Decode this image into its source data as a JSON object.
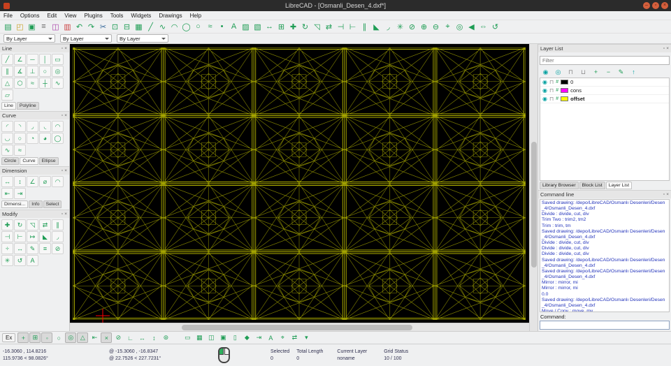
{
  "window": {
    "title": "LibreCAD - [Osmanli_Desen_4.dxf*]",
    "controls": {
      "minimize": "–",
      "maximize": "▫",
      "close": "×"
    }
  },
  "dock_icons": {
    "float": "▫",
    "close": "×"
  },
  "menu": {
    "items": [
      "File",
      "Options",
      "Edit",
      "View",
      "Plugins",
      "Tools",
      "Widgets",
      "Drawings",
      "Help"
    ]
  },
  "toolbar_main": {
    "icons": [
      {
        "name": "new-file-icon",
        "glyph": "▤"
      },
      {
        "name": "open-file-icon",
        "glyph": "◰",
        "color": "#c9a227"
      },
      {
        "name": "save-icon",
        "glyph": "▣"
      },
      {
        "name": "print-icon",
        "glyph": "≡",
        "color": "#666666"
      },
      {
        "name": "print-preview-icon",
        "glyph": "◫",
        "color": "#aa44aa"
      },
      {
        "name": "export-pdf-icon",
        "glyph": "▥",
        "color": "#cc4444"
      },
      {
        "name": "undo-icon",
        "glyph": "↶"
      },
      {
        "name": "redo-icon",
        "glyph": "↷"
      },
      {
        "name": "cut-icon",
        "glyph": "✂",
        "color": "#336699"
      },
      {
        "name": "copy-icon",
        "glyph": "⊡"
      },
      {
        "name": "paste-icon",
        "glyph": "⊟"
      },
      {
        "name": "grid-icon",
        "glyph": "▦"
      },
      {
        "name": "line-icon",
        "glyph": "╱"
      },
      {
        "name": "polyline-icon",
        "glyph": "∿"
      },
      {
        "name": "arc-icon",
        "glyph": "◠"
      },
      {
        "name": "circle-icon",
        "glyph": "◯"
      },
      {
        "name": "ellipse-icon",
        "glyph": "○"
      },
      {
        "name": "spline-icon",
        "glyph": "≈"
      },
      {
        "name": "point-icon",
        "glyph": "•"
      },
      {
        "name": "text-icon",
        "glyph": "A"
      },
      {
        "name": "hatch-icon",
        "glyph": "▨"
      },
      {
        "name": "image-icon",
        "glyph": "▧"
      },
      {
        "name": "dimension-icon",
        "glyph": "↔"
      },
      {
        "name": "block-icon",
        "glyph": "⊞"
      },
      {
        "name": "move-icon",
        "glyph": "✚"
      },
      {
        "name": "rotate-icon",
        "glyph": "↻"
      },
      {
        "name": "scale-icon",
        "glyph": "◹"
      },
      {
        "name": "mirror-icon",
        "glyph": "⇄"
      },
      {
        "name": "trim-icon",
        "glyph": "⊣"
      },
      {
        "name": "lengthen-icon",
        "glyph": "⊢"
      },
      {
        "name": "offset-icon",
        "glyph": "∥"
      },
      {
        "name": "bevel-icon",
        "glyph": "◣"
      },
      {
        "name": "fillet-icon",
        "glyph": "◞"
      },
      {
        "name": "explode-icon",
        "glyph": "✳"
      },
      {
        "name": "delete-icon",
        "glyph": "⊘"
      },
      {
        "name": "zoom-in-icon",
        "glyph": "⊕"
      },
      {
        "name": "zoom-out-icon",
        "glyph": "⊖"
      },
      {
        "name": "zoom-window-icon",
        "glyph": "⌖"
      },
      {
        "name": "zoom-auto-icon",
        "glyph": "◎"
      },
      {
        "name": "zoom-previous-icon",
        "glyph": "◀"
      },
      {
        "name": "pan-icon",
        "glyph": "⇔"
      },
      {
        "name": "redraw-icon",
        "glyph": "↺"
      }
    ]
  },
  "pen_toolbar": {
    "combos": [
      {
        "value": "By Layer"
      },
      {
        "value": "By Layer"
      },
      {
        "value": "By Layer"
      }
    ]
  },
  "left_dock": {
    "line_panel": {
      "title": "Line",
      "icons": [
        {
          "name": "line-two-points-icon",
          "glyph": "╱"
        },
        {
          "name": "line-angle-icon",
          "glyph": "∠"
        },
        {
          "name": "line-horizontal-icon",
          "glyph": "─"
        },
        {
          "name": "line-vertical-icon",
          "glyph": "│"
        },
        {
          "name": "line-rectangle-icon",
          "glyph": "▭"
        },
        {
          "name": "line-parallel-icon",
          "glyph": "∥"
        },
        {
          "name": "line-bisector-icon",
          "glyph": "∡"
        },
        {
          "name": "line-perpendicular-icon",
          "glyph": "⊥"
        },
        {
          "name": "line-tangent-point-icon",
          "glyph": "○"
        },
        {
          "name": "line-tangent-circles-icon",
          "glyph": "◎"
        },
        {
          "name": "line-polygon-icon",
          "glyph": "△"
        },
        {
          "name": "line-polygon-two-vertex-icon",
          "glyph": "⬡"
        },
        {
          "name": "line-freehand-icon",
          "glyph": "≈"
        },
        {
          "name": "line-cross-icon",
          "glyph": "┼"
        },
        {
          "name": "line-wave-icon",
          "glyph": "∿"
        },
        {
          "name": "line-ortho-icon",
          "glyph": "▱"
        }
      ],
      "tabs": [
        {
          "label": "Line",
          "active": true
        },
        {
          "label": "Polyline"
        }
      ]
    },
    "curve_panel": {
      "title": "Curve",
      "icons": [
        {
          "name": "arc-three-points-icon",
          "glyph": "◜"
        },
        {
          "name": "arc-center-point-icon",
          "glyph": "◝"
        },
        {
          "name": "arc-tangent-icon",
          "glyph": "◞"
        },
        {
          "name": "arc-concentric-icon",
          "glyph": "◟"
        },
        {
          "name": "arc-top-icon",
          "glyph": "◠"
        },
        {
          "name": "arc-bottom-icon",
          "glyph": "◡"
        },
        {
          "name": "circle-center-icon",
          "glyph": "○"
        },
        {
          "name": "circle-quarter-icon",
          "glyph": "◔"
        },
        {
          "name": "circle-three-quarter-icon",
          "glyph": "◕"
        },
        {
          "name": "circle-two-points-icon",
          "glyph": "◯"
        },
        {
          "name": "spline-points-icon",
          "glyph": "∿"
        },
        {
          "name": "freehand-curve-icon",
          "glyph": "≈"
        }
      ],
      "tabs": [
        {
          "label": "Circle"
        },
        {
          "label": "Curve",
          "active": true
        },
        {
          "label": "Ellipse"
        }
      ]
    },
    "dimension_panel": {
      "title": "Dimension",
      "icons": [
        {
          "name": "dim-aligned-icon",
          "glyph": "↔"
        },
        {
          "name": "dim-linear-icon",
          "glyph": "↕"
        },
        {
          "name": "dim-angular-icon",
          "glyph": "∠"
        },
        {
          "name": "dim-diametric-icon",
          "glyph": "⌀"
        },
        {
          "name": "dim-arc-icon",
          "glyph": "◠"
        },
        {
          "name": "dim-leader-icon",
          "glyph": "⇤"
        },
        {
          "name": "dim-baseline-icon",
          "glyph": "⇥"
        }
      ],
      "tabs": [
        {
          "label": "Dimensi...",
          "active": true
        },
        {
          "label": "Info"
        },
        {
          "label": "Select"
        }
      ]
    },
    "modify_panel": {
      "title": "Modify",
      "icons": [
        {
          "name": "modify-move-icon",
          "glyph": "✚"
        },
        {
          "name": "modify-rotate-icon",
          "glyph": "↻"
        },
        {
          "name": "modify-scale-icon",
          "glyph": "◹"
        },
        {
          "name": "modify-mirror-icon",
          "glyph": "⇄"
        },
        {
          "name": "modify-offset-icon",
          "glyph": "∥"
        },
        {
          "name": "modify-trim-icon",
          "glyph": "⊣"
        },
        {
          "name": "modify-trim-two-icon",
          "glyph": "⊢"
        },
        {
          "name": "modify-lengthen-icon",
          "glyph": "↦"
        },
        {
          "name": "modify-bevel-icon",
          "glyph": "◣"
        },
        {
          "name": "modify-fillet-icon",
          "glyph": "◞"
        },
        {
          "name": "modify-divide-icon",
          "glyph": "÷"
        },
        {
          "name": "modify-stretch-icon",
          "glyph": "↔"
        },
        {
          "name": "modify-properties-icon",
          "glyph": "✎"
        },
        {
          "name": "modify-attributes-icon",
          "glyph": "≡"
        },
        {
          "name": "modify-delete-icon",
          "glyph": "⊘"
        },
        {
          "name": "modify-explode-icon",
          "glyph": "✳"
        },
        {
          "name": "modify-revert-icon",
          "glyph": "↺"
        },
        {
          "name": "modify-text-icon",
          "glyph": "A"
        }
      ]
    }
  },
  "canvas": {
    "background": "#000000",
    "pattern_color": "#8a8a00",
    "pattern_color_strong": "#b2b200",
    "origin_color": "#ff0000"
  },
  "layer_list": {
    "title": "Layer List",
    "filter_placeholder": "Filter",
    "toolbar": [
      {
        "name": "show-all-layers-icon",
        "glyph": "◉",
        "color": "#00a0a0"
      },
      {
        "name": "hide-all-layers-icon",
        "glyph": "◎",
        "color": "#00a0a0"
      },
      {
        "name": "lock-all-layers-icon",
        "glyph": "⊓",
        "color": "#888888"
      },
      {
        "name": "unlock-all-layers-icon",
        "glyph": "⊔",
        "color": "#888888"
      },
      {
        "name": "add-layer-icon",
        "glyph": "+",
        "color": "#1f9d55"
      },
      {
        "name": "remove-layer-icon",
        "glyph": "−",
        "color": "#1f9d55"
      },
      {
        "name": "edit-layer-icon",
        "glyph": "✎",
        "color": "#1f9d55"
      },
      {
        "name": "layer-up-icon",
        "glyph": "↑",
        "color": "#00a0a0"
      }
    ],
    "glyphs": {
      "eye": "◉",
      "lock": "⊓",
      "construction": "#"
    },
    "layers": [
      {
        "name": "0",
        "color": "#000000"
      },
      {
        "name": "cons",
        "color": "#ff00ff"
      },
      {
        "name": "offset",
        "color": "#ffff00",
        "active": true
      }
    ],
    "tabs": [
      {
        "label": "Library Browser"
      },
      {
        "label": "Block List"
      },
      {
        "label": "Layer List",
        "active": true
      }
    ]
  },
  "command_line": {
    "title": "Command line",
    "history": [
      "Saved drawing: /depo/LibreCAD/Osmanlı Desenleri/Desen_4/Osmanli_Desen_4.dxf",
      "Divide : divide, cut, div",
      "Trim Two : trim2, tm2",
      "Trim : trim, tm",
      "Saved drawing: /depo/LibreCAD/Osmanlı Desenleri/Desen_4/Osmanli_Desen_4.dxf",
      "Divide : divide, cut, div",
      "Divide : divide, cut, div",
      "Divide : divide, cut, div",
      "Saved drawing: /depo/LibreCAD/Osmanlı Desenleri/Desen_4/Osmanli_Desen_4.dxf",
      "Saved drawing: /depo/LibreCAD/Osmanlı Desenleri/Desen_4/Osmanli_Desen_4.dxf",
      "Mirror : mirror, mi",
      "Mirror : mirror, mi",
      "0.0",
      "Saved drawing: /depo/LibreCAD/Osmanlı Desenleri/Desen_4/Osmanli_Desen_4.dxf",
      "Move / Copy : move, mv",
      "Move / Copy : move, mv"
    ],
    "prompt": "Command:"
  },
  "snap_toolbar": {
    "ex_label": "Ex",
    "left_icons": [
      {
        "name": "snap-free-icon",
        "glyph": "+",
        "active": true
      },
      {
        "name": "snap-grid-icon",
        "glyph": "⊞",
        "active": true
      },
      {
        "name": "snap-endpoint-icon",
        "glyph": "◦",
        "active": true
      },
      {
        "name": "snap-on-entity-icon",
        "glyph": "○"
      },
      {
        "name": "snap-center-icon",
        "glyph": "◎",
        "active": true
      },
      {
        "name": "snap-middle-icon",
        "glyph": "△",
        "active": true
      },
      {
        "name": "snap-distance-icon",
        "glyph": "⇤"
      },
      {
        "name": "snap-intersection-icon",
        "glyph": "×",
        "active": true
      },
      {
        "name": "restrict-nothing-icon",
        "glyph": "⊘"
      },
      {
        "name": "restrict-orthogonal-icon",
        "glyph": "∟"
      },
      {
        "name": "restrict-horizontal-icon",
        "glyph": "↔"
      },
      {
        "name": "restrict-vertical-icon",
        "glyph": "↕"
      },
      {
        "name": "lock-relative-zero-icon",
        "glyph": "⊚"
      }
    ],
    "right_icons": [
      {
        "name": "draft-mode-icon",
        "glyph": "▭"
      },
      {
        "name": "toggle-grid-icon",
        "glyph": "▦"
      },
      {
        "name": "toggle-preview-icon",
        "glyph": "◫"
      },
      {
        "name": "toggle-panel-icon",
        "glyph": "▣"
      },
      {
        "name": "toggle-statusbar-icon",
        "glyph": "▯"
      },
      {
        "name": "selection-pointer-icon",
        "glyph": "◆"
      },
      {
        "name": "deselect-icon",
        "glyph": "⇥"
      },
      {
        "name": "text-tool-icon",
        "glyph": "A"
      },
      {
        "name": "target-icon",
        "glyph": "⌖"
      },
      {
        "name": "swap-icon",
        "glyph": "⇄"
      },
      {
        "name": "more-options-icon",
        "glyph": "▾"
      }
    ]
  },
  "status_bar": {
    "abs_coords": "-16.3060 , 114.8216",
    "abs_polar": "115.9736 < 98.0826°",
    "rel_coords": "@ -15.3060 , -16.8347",
    "rel_polar": "@ 22.7526 < 227.7231°",
    "selected_label": "Selected",
    "selected_value": "0",
    "total_length_label": "Total Length",
    "total_length_value": "0",
    "current_layer_label": "Current Layer",
    "current_layer_value": "noname",
    "grid_status_label": "Grid Status",
    "grid_status_value": "10 / 100"
  }
}
